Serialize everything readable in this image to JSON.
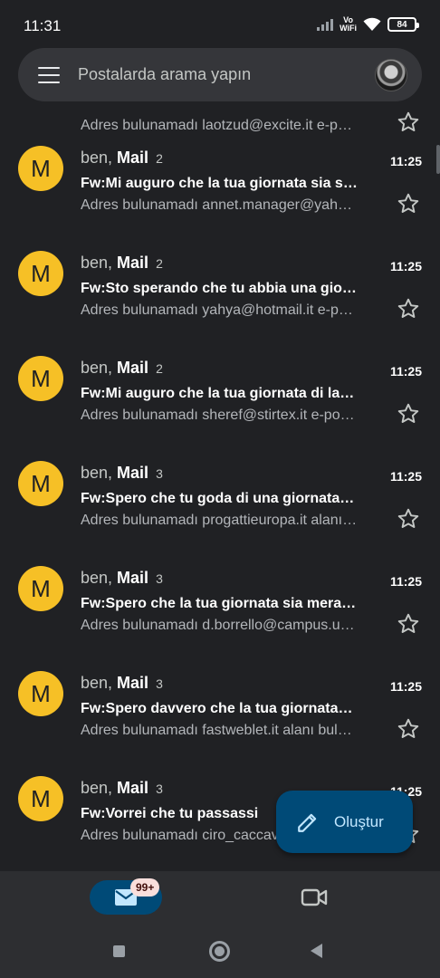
{
  "status_bar": {
    "time": "11:31",
    "volte_line1": "Vo",
    "volte_line2": "WiFi",
    "battery": "84"
  },
  "search": {
    "placeholder": "Postalarda arama yapın"
  },
  "partial_item": {
    "snippet": "Adres bulunamadı laotzud@excite.it e-p…"
  },
  "mails": [
    {
      "avatar": "M",
      "sender_prefix": "ben, ",
      "sender_name": "Mail",
      "count": "2",
      "time": "11:25",
      "subject": "Fw:Mi auguro che la tua giornata sia s…",
      "snippet": "Adres bulunamadı annet.manager@yah…"
    },
    {
      "avatar": "M",
      "sender_prefix": "ben, ",
      "sender_name": "Mail",
      "count": "2",
      "time": "11:25",
      "subject": "Fw:Sto sperando che tu abbia una gio…",
      "snippet": "Adres bulunamadı yahya@hotmail.it e-p…"
    },
    {
      "avatar": "M",
      "sender_prefix": "ben, ",
      "sender_name": "Mail",
      "count": "2",
      "time": "11:25",
      "subject": "Fw:Mi auguro che la tua giornata di la…",
      "snippet": "Adres bulunamadı sheref@stirtex.it e-po…"
    },
    {
      "avatar": "M",
      "sender_prefix": "ben, ",
      "sender_name": "Mail",
      "count": "3",
      "time": "11:25",
      "subject": "Fw:Spero che tu goda di una giornata…",
      "snippet": "Adres bulunamadı progattieuropa.it alanı…"
    },
    {
      "avatar": "M",
      "sender_prefix": "ben, ",
      "sender_name": "Mail",
      "count": "3",
      "time": "11:25",
      "subject": "Fw:Spero che la tua giornata sia mera…",
      "snippet": "Adres bulunamadı d.borrello@campus.u…"
    },
    {
      "avatar": "M",
      "sender_prefix": "ben, ",
      "sender_name": "Mail",
      "count": "3",
      "time": "11:25",
      "subject": "Fw:Spero davvero che la tua giornata…",
      "snippet": "Adres bulunamadı fastweblet.it alanı bul…"
    },
    {
      "avatar": "M",
      "sender_prefix": "ben, ",
      "sender_name": "Mail",
      "count": "3",
      "time": "11:25",
      "subject": "Fw:Vorrei che tu passassi",
      "snippet": "Adres bulunamadı ciro_caccavale@fast…"
    }
  ],
  "fab": {
    "label": "Oluştur"
  },
  "bottom_nav": {
    "mail_badge": "99+"
  },
  "colors": {
    "background": "#202124",
    "avatar": "#f6c026",
    "fab": "#004a77",
    "badge": "#f9dedc"
  }
}
